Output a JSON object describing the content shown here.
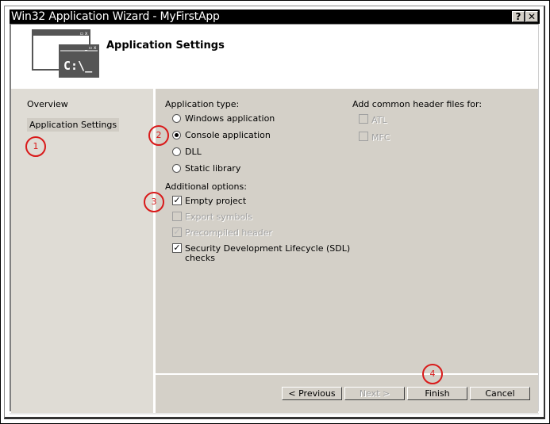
{
  "window": {
    "title": "Win32 Application Wizard - MyFirstApp",
    "help_button": "?",
    "close_button": "✕"
  },
  "header": {
    "title": "Application Settings",
    "icon_prompt": "C:\\_",
    "icon_window_controls": "_ ▫ x"
  },
  "sidebar": {
    "items": [
      {
        "label": "Overview",
        "selected": false
      },
      {
        "label": "Application Settings",
        "selected": true
      }
    ]
  },
  "application_type": {
    "label": "Application type:",
    "options": [
      {
        "label": "Windows application",
        "checked": false
      },
      {
        "label": "Console application",
        "checked": true
      },
      {
        "label": "DLL",
        "checked": false
      },
      {
        "label": "Static library",
        "checked": false
      }
    ]
  },
  "additional_options": {
    "label": "Additional options:",
    "options": [
      {
        "label": "Empty project",
        "checked": true,
        "enabled": true,
        "mark": "✓"
      },
      {
        "label": "Export symbols",
        "checked": false,
        "enabled": false,
        "mark": ""
      },
      {
        "label": "Precompiled header",
        "checked": true,
        "enabled": false,
        "mark": "✓"
      },
      {
        "label": "Security Development Lifecycle (SDL)",
        "label_line2": "checks",
        "checked": true,
        "enabled": true,
        "mark": "✓"
      }
    ]
  },
  "common_headers": {
    "label": "Add common header files for:",
    "options": [
      {
        "label": "ATL",
        "checked": false,
        "enabled": false
      },
      {
        "label": "MFC",
        "checked": false,
        "enabled": false
      }
    ]
  },
  "buttons": {
    "previous": "< Previous",
    "next": "Next >",
    "finish": "Finish",
    "cancel": "Cancel"
  },
  "annotations": [
    "1",
    "2",
    "3",
    "4"
  ],
  "colors": {
    "annotation": "#d91a1a",
    "titlebar": "#000000",
    "dialog_face": "#d4d0c8",
    "sidebar": "#dfdcd5"
  }
}
